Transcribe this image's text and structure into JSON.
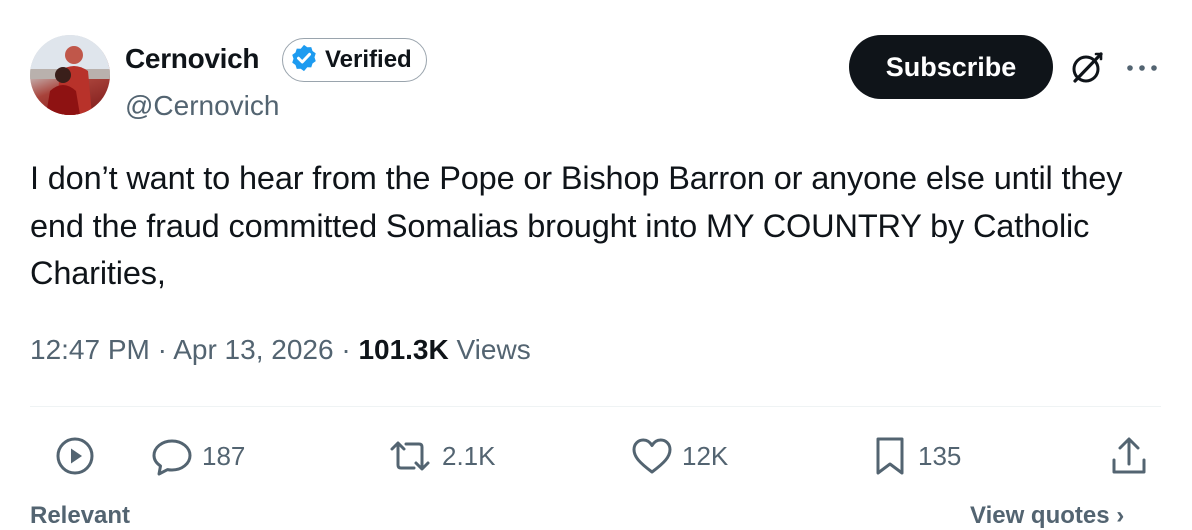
{
  "author": {
    "name": "Cernovich",
    "verified_label": "Verified",
    "handle": "@Cernovich"
  },
  "subscribe_label": "Subscribe",
  "post": {
    "text": "I don’t want to hear from the Pope or Bishop Barron or anyone else until they end the fraud committed Somalias brought into MY COUNTRY by Catholic Charities,"
  },
  "meta": {
    "time": "12:47 PM",
    "date": "Apr 13, 2026",
    "views_count": "101.3K",
    "views_label": "Views"
  },
  "actions": {
    "replies": "187",
    "reposts": "2.1K",
    "likes": "12K",
    "bookmarks": "135"
  },
  "bottom": {
    "left": "Relevant",
    "right": "View quotes ›"
  },
  "colors": {
    "verified_blue": "#1d9bf0",
    "text_primary": "#0f1419",
    "text_secondary": "#536471",
    "button_dark": "#0f1419"
  },
  "icons": [
    "play-icon",
    "reply-icon",
    "repost-icon",
    "like-icon",
    "bookmark-icon",
    "share-icon",
    "grok-icon",
    "more-icon",
    "verified-badge-icon"
  ]
}
